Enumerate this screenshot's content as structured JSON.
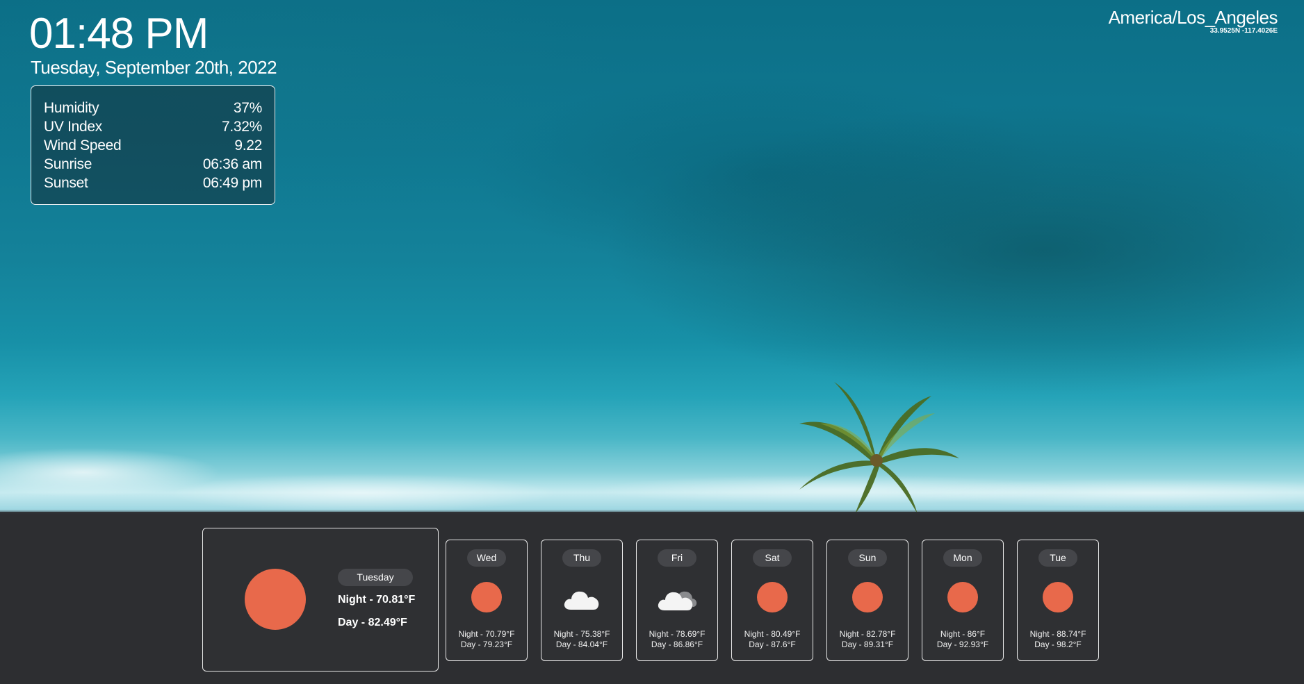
{
  "clock": {
    "time": "01:48 PM",
    "date": "Tuesday, September 20th, 2022"
  },
  "details": [
    {
      "label": "Humidity",
      "value": "37%"
    },
    {
      "label": "UV Index",
      "value": "7.32%"
    },
    {
      "label": "Wind Speed",
      "value": "9.22"
    },
    {
      "label": "Sunrise",
      "value": "06:36 am"
    },
    {
      "label": "Sunset",
      "value": "06:49 pm"
    }
  ],
  "location": {
    "timezone": "America/Los_Angeles",
    "coordinates": "33.9525N -117.4026E"
  },
  "today": {
    "day": "Tuesday",
    "icon": "sun-icon",
    "night": "Night - 70.81°F",
    "daytime": "Day - 82.49°F"
  },
  "forecast": [
    {
      "day": "Wed",
      "icon": "sun-icon",
      "night": "Night - 70.79°F",
      "daytime": "Day - 79.23°F"
    },
    {
      "day": "Thu",
      "icon": "cloud-icon",
      "night": "Night - 75.38°F",
      "daytime": "Day - 84.04°F"
    },
    {
      "day": "Fri",
      "icon": "cloud-icon",
      "night": "Night - 78.69°F",
      "daytime": "Day - 86.86°F"
    },
    {
      "day": "Sat",
      "icon": "sun-icon",
      "night": "Night - 80.49°F",
      "daytime": "Day - 87.6°F"
    },
    {
      "day": "Sun",
      "icon": "sun-icon",
      "night": "Night - 82.78°F",
      "daytime": "Day - 89.31°F"
    },
    {
      "day": "Mon",
      "icon": "sun-icon",
      "night": "Night - 86°F",
      "daytime": "Day - 92.93°F"
    },
    {
      "day": "Tue",
      "icon": "sun-icon",
      "night": "Night - 88.74°F",
      "daytime": "Day - 98.2°F"
    }
  ],
  "colors": {
    "sun": "#e8694b",
    "panel": "#2d2e31",
    "pill": "#45464a"
  }
}
